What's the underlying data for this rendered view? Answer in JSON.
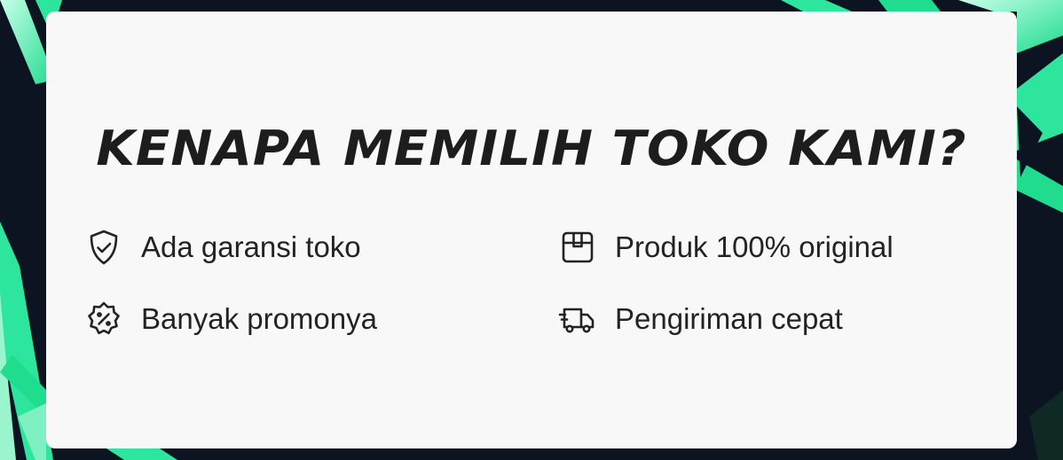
{
  "heading": "KENAPA MEMILIH TOKO KAMI?",
  "features": [
    {
      "icon": "shield-check-icon",
      "label": "Ada garansi toko"
    },
    {
      "icon": "promo-badge-icon",
      "label": "Banyak promonya"
    },
    {
      "icon": "box-icon",
      "label": "Produk 100% original"
    },
    {
      "icon": "delivery-truck-icon",
      "label": "Pengiriman cepat"
    }
  ],
  "colors": {
    "background": "#0c1421",
    "accent": "#2ee59d",
    "card": "#f8f8f8",
    "text": "#1d1d1d"
  }
}
